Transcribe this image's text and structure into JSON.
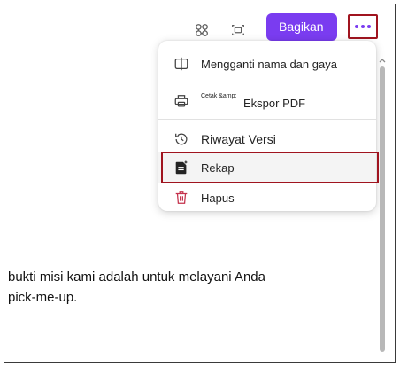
{
  "toolbar": {
    "icons": [
      "loop-components-icon",
      "present-icon"
    ],
    "share_label": "Bagikan",
    "more_icon": "more-horizontal-icon"
  },
  "menu": {
    "items": [
      {
        "label": "Mengganti nama dan gaya",
        "icon": "rename-icon"
      },
      {
        "small_label": "Cetak &amp;",
        "label": "Ekspor PDF",
        "icon": "print-icon"
      },
      {
        "label": "Riwayat Versi",
        "icon": "history-icon"
      },
      {
        "label": "Rekap",
        "icon": "recap-icon",
        "highlighted": true
      },
      {
        "label": "Hapus",
        "icon": "trash-icon"
      }
    ]
  },
  "document": {
    "lines": [
      "bukti misi kami adalah untuk melayani Anda",
      "pick-me-up."
    ]
  },
  "colors": {
    "accent": "#7a3cf0",
    "highlight_border": "#a0141f",
    "delete": "#c4314b"
  }
}
